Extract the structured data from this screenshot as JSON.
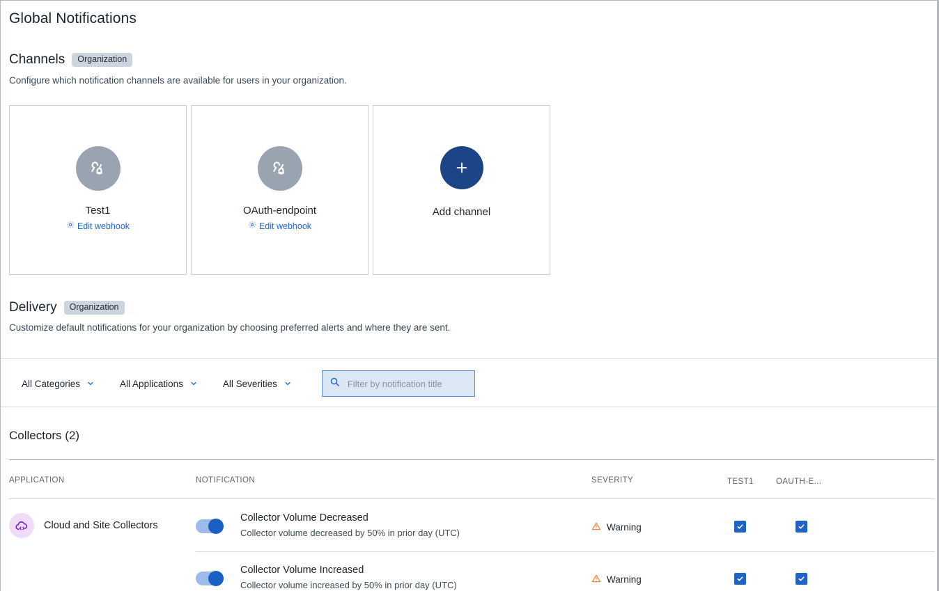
{
  "page": {
    "title": "Global Notifications"
  },
  "channels": {
    "heading": "Channels",
    "badge": "Organization",
    "description": "Configure which notification channels are available for users in your organization.",
    "cards": [
      {
        "name": "Test1",
        "action": "Edit webhook",
        "icon": "webhook-icon"
      },
      {
        "name": "OAuth-endpoint",
        "action": "Edit webhook",
        "icon": "webhook-icon"
      }
    ],
    "add_card": {
      "label": "Add channel",
      "icon": "plus-icon"
    }
  },
  "delivery": {
    "heading": "Delivery",
    "badge": "Organization",
    "description": "Customize default notifications for your organization by choosing preferred alerts and where they are sent."
  },
  "filters": {
    "categories": "All Categories",
    "applications": "All Applications",
    "severities": "All Severities",
    "search_placeholder": "Filter by notification title",
    "search_value": ""
  },
  "table": {
    "group_title": "Collectors (2)",
    "columns": {
      "application": "APPLICATION",
      "notification": "NOTIFICATION",
      "severity": "SEVERITY",
      "channels": [
        "TEST1",
        "OAUTH-E..."
      ]
    },
    "application": {
      "label": "Cloud and Site Collectors",
      "icon": "cloud-code-icon"
    },
    "rows": [
      {
        "enabled": true,
        "title": "Collector Volume Decreased",
        "subtitle": "Collector volume decreased by 50% in prior day (UTC)",
        "severity": "Warning",
        "severity_icon": "warning-triangle-icon",
        "channels": [
          true,
          true
        ]
      },
      {
        "enabled": true,
        "title": "Collector Volume Increased",
        "subtitle": "Collector volume increased by 50% in prior day (UTC)",
        "severity": "Warning",
        "severity_icon": "warning-triangle-icon",
        "channels": [
          true,
          true
        ]
      }
    ]
  },
  "colors": {
    "accent_blue": "#2166d8",
    "add_button": "#1c4587",
    "badge_bg": "#ccd5de",
    "avatar_gray": "#9aa3b0",
    "warning_orange": "#f07b28",
    "app_icon_bg": "#efdcfb",
    "app_icon_fg": "#7b18c8",
    "checkbox_blue": "#2063c4",
    "toggle_track": "#9dbbe8",
    "toggle_knob": "#1a5fc4"
  }
}
